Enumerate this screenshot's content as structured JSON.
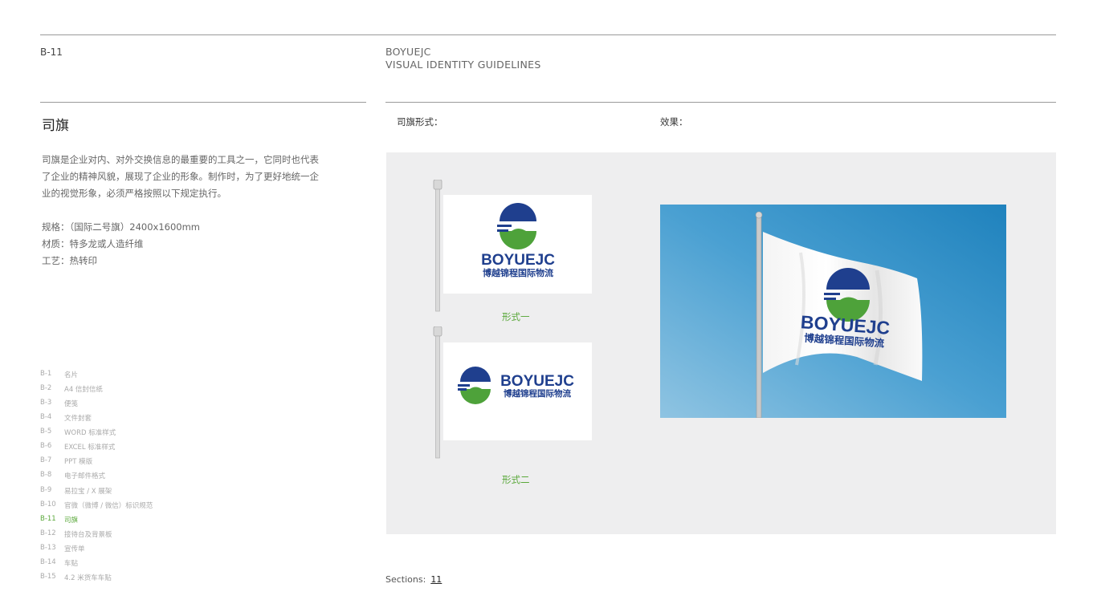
{
  "header": {
    "page_code": "B-11",
    "brand": "BOYUEJC",
    "subtitle": "VISUAL IDENTITY GUIDELINES"
  },
  "section": {
    "title": "司旗",
    "description": [
      "司旗是企业对内、对外交换信息的最重要的工具之一，它同时也代表",
      "了企业的精神风貌，展现了企业的形象。制作时，为了更好地统一企",
      "业的视觉形象，必须严格按照以下规定执行。"
    ],
    "specs": [
      "规格：（国际二号旗）2400x1600mm",
      "材质：特多龙或人造纤维",
      "工艺：热转印"
    ]
  },
  "labels": {
    "form": "司旗形式：",
    "effect": "效果："
  },
  "flags": [
    {
      "caption": "形式一"
    },
    {
      "caption": "形式二"
    }
  ],
  "logo": {
    "wordmark": "BOYUEJC",
    "chinese": "博越锦程国际物流",
    "colors": {
      "blue": "#1f3f8e",
      "green": "#4ea23a"
    }
  },
  "toc": [
    {
      "code": "B-1",
      "name": "名片"
    },
    {
      "code": "B-2",
      "name": "A4 信封信纸"
    },
    {
      "code": "B-3",
      "name": "便笺"
    },
    {
      "code": "B-4",
      "name": "文件封套"
    },
    {
      "code": "B-5",
      "name": "WORD 标准样式"
    },
    {
      "code": "B-6",
      "name": "EXCEL 标准样式"
    },
    {
      "code": "B-7",
      "name": "PPT 模版"
    },
    {
      "code": "B-8",
      "name": "电子邮件格式"
    },
    {
      "code": "B-9",
      "name": "易拉宝 / X 展架"
    },
    {
      "code": "B-10",
      "name": "官微（微博 / 微信）标识规范"
    },
    {
      "code": "B-11",
      "name": "司旗",
      "active": true
    },
    {
      "code": "B-12",
      "name": "接待台及背景板"
    },
    {
      "code": "B-13",
      "name": "宣传单"
    },
    {
      "code": "B-14",
      "name": "车贴"
    },
    {
      "code": "B-15",
      "name": "4.2 米货车车贴"
    }
  ],
  "footer": {
    "sections_label": "Sections:",
    "sections_number": "11"
  }
}
